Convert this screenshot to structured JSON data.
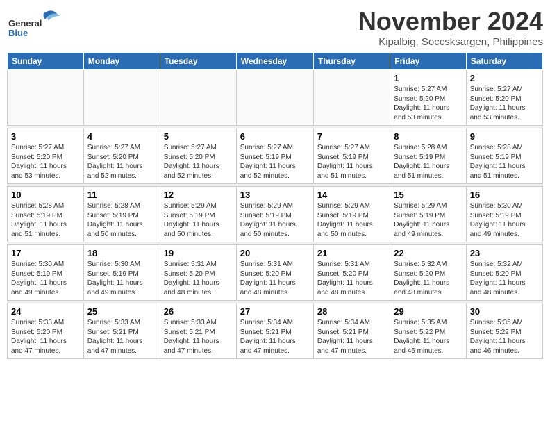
{
  "logo": {
    "text_general": "General",
    "text_blue": "Blue"
  },
  "title": "November 2024",
  "subtitle": "Kipalbig, Soccsksargen, Philippines",
  "days_of_week": [
    "Sunday",
    "Monday",
    "Tuesday",
    "Wednesday",
    "Thursday",
    "Friday",
    "Saturday"
  ],
  "weeks": [
    [
      {
        "day": "",
        "info": ""
      },
      {
        "day": "",
        "info": ""
      },
      {
        "day": "",
        "info": ""
      },
      {
        "day": "",
        "info": ""
      },
      {
        "day": "",
        "info": ""
      },
      {
        "day": "1",
        "info": "Sunrise: 5:27 AM\nSunset: 5:20 PM\nDaylight: 11 hours\nand 53 minutes."
      },
      {
        "day": "2",
        "info": "Sunrise: 5:27 AM\nSunset: 5:20 PM\nDaylight: 11 hours\nand 53 minutes."
      }
    ],
    [
      {
        "day": "3",
        "info": "Sunrise: 5:27 AM\nSunset: 5:20 PM\nDaylight: 11 hours\nand 53 minutes."
      },
      {
        "day": "4",
        "info": "Sunrise: 5:27 AM\nSunset: 5:20 PM\nDaylight: 11 hours\nand 52 minutes."
      },
      {
        "day": "5",
        "info": "Sunrise: 5:27 AM\nSunset: 5:20 PM\nDaylight: 11 hours\nand 52 minutes."
      },
      {
        "day": "6",
        "info": "Sunrise: 5:27 AM\nSunset: 5:19 PM\nDaylight: 11 hours\nand 52 minutes."
      },
      {
        "day": "7",
        "info": "Sunrise: 5:27 AM\nSunset: 5:19 PM\nDaylight: 11 hours\nand 51 minutes."
      },
      {
        "day": "8",
        "info": "Sunrise: 5:28 AM\nSunset: 5:19 PM\nDaylight: 11 hours\nand 51 minutes."
      },
      {
        "day": "9",
        "info": "Sunrise: 5:28 AM\nSunset: 5:19 PM\nDaylight: 11 hours\nand 51 minutes."
      }
    ],
    [
      {
        "day": "10",
        "info": "Sunrise: 5:28 AM\nSunset: 5:19 PM\nDaylight: 11 hours\nand 51 minutes."
      },
      {
        "day": "11",
        "info": "Sunrise: 5:28 AM\nSunset: 5:19 PM\nDaylight: 11 hours\nand 50 minutes."
      },
      {
        "day": "12",
        "info": "Sunrise: 5:29 AM\nSunset: 5:19 PM\nDaylight: 11 hours\nand 50 minutes."
      },
      {
        "day": "13",
        "info": "Sunrise: 5:29 AM\nSunset: 5:19 PM\nDaylight: 11 hours\nand 50 minutes."
      },
      {
        "day": "14",
        "info": "Sunrise: 5:29 AM\nSunset: 5:19 PM\nDaylight: 11 hours\nand 50 minutes."
      },
      {
        "day": "15",
        "info": "Sunrise: 5:29 AM\nSunset: 5:19 PM\nDaylight: 11 hours\nand 49 minutes."
      },
      {
        "day": "16",
        "info": "Sunrise: 5:30 AM\nSunset: 5:19 PM\nDaylight: 11 hours\nand 49 minutes."
      }
    ],
    [
      {
        "day": "17",
        "info": "Sunrise: 5:30 AM\nSunset: 5:19 PM\nDaylight: 11 hours\nand 49 minutes."
      },
      {
        "day": "18",
        "info": "Sunrise: 5:30 AM\nSunset: 5:19 PM\nDaylight: 11 hours\nand 49 minutes."
      },
      {
        "day": "19",
        "info": "Sunrise: 5:31 AM\nSunset: 5:20 PM\nDaylight: 11 hours\nand 48 minutes."
      },
      {
        "day": "20",
        "info": "Sunrise: 5:31 AM\nSunset: 5:20 PM\nDaylight: 11 hours\nand 48 minutes."
      },
      {
        "day": "21",
        "info": "Sunrise: 5:31 AM\nSunset: 5:20 PM\nDaylight: 11 hours\nand 48 minutes."
      },
      {
        "day": "22",
        "info": "Sunrise: 5:32 AM\nSunset: 5:20 PM\nDaylight: 11 hours\nand 48 minutes."
      },
      {
        "day": "23",
        "info": "Sunrise: 5:32 AM\nSunset: 5:20 PM\nDaylight: 11 hours\nand 48 minutes."
      }
    ],
    [
      {
        "day": "24",
        "info": "Sunrise: 5:33 AM\nSunset: 5:20 PM\nDaylight: 11 hours\nand 47 minutes."
      },
      {
        "day": "25",
        "info": "Sunrise: 5:33 AM\nSunset: 5:21 PM\nDaylight: 11 hours\nand 47 minutes."
      },
      {
        "day": "26",
        "info": "Sunrise: 5:33 AM\nSunset: 5:21 PM\nDaylight: 11 hours\nand 47 minutes."
      },
      {
        "day": "27",
        "info": "Sunrise: 5:34 AM\nSunset: 5:21 PM\nDaylight: 11 hours\nand 47 minutes."
      },
      {
        "day": "28",
        "info": "Sunrise: 5:34 AM\nSunset: 5:21 PM\nDaylight: 11 hours\nand 47 minutes."
      },
      {
        "day": "29",
        "info": "Sunrise: 5:35 AM\nSunset: 5:22 PM\nDaylight: 11 hours\nand 46 minutes."
      },
      {
        "day": "30",
        "info": "Sunrise: 5:35 AM\nSunset: 5:22 PM\nDaylight: 11 hours\nand 46 minutes."
      }
    ]
  ]
}
